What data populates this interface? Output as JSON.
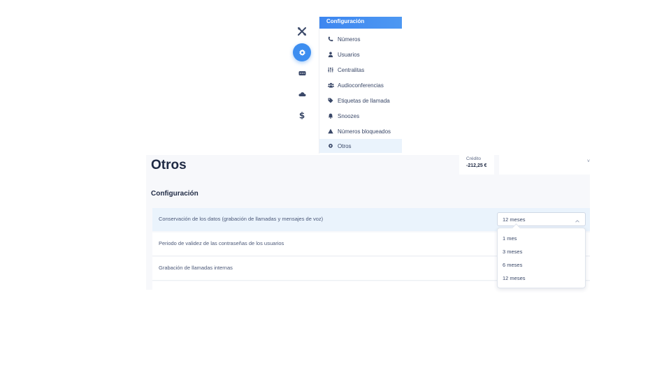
{
  "menu": {
    "header": "Configuración",
    "items": [
      {
        "label": "Números",
        "icon": "phone-icon"
      },
      {
        "label": "Usuarios",
        "icon": "user-icon"
      },
      {
        "label": "Centralitas",
        "icon": "sliders-icon"
      },
      {
        "label": "Audioconferencias",
        "icon": "users-icon"
      },
      {
        "label": "Etiquetas de llamada",
        "icon": "tag-icon"
      },
      {
        "label": "Snoozes",
        "icon": "bell-icon"
      },
      {
        "label": "Números bloqueados",
        "icon": "warning-icon"
      },
      {
        "label": "Otros",
        "icon": "gear-icon"
      }
    ],
    "active_item": "Otros"
  },
  "rail": {
    "icons": [
      "tools-icon",
      "gear-icon",
      "message-icon",
      "cloud-icon",
      "dollar-icon"
    ],
    "active_icon": "gear-icon"
  },
  "page": {
    "title": "Otros",
    "section_title": "Configuración"
  },
  "credit": {
    "label": "Crédito",
    "value": "-212,25 €"
  },
  "settings": {
    "rows": [
      {
        "label": "Conservación de los datos (grabación de llamadas y mensajes de voz)"
      },
      {
        "label": "Periodo de validez de las contraseñas de los usuarios"
      },
      {
        "label": "Grabación de llamadas internas"
      }
    ],
    "retention_select": {
      "value": "12 meses",
      "options": [
        "1 mes",
        "3 meses",
        "6 meses",
        "12 meses"
      ]
    }
  },
  "colors": {
    "accent": "#3d8ef0",
    "active_row_bg": "#eaf3fc",
    "text_dark": "#1f2a44"
  }
}
